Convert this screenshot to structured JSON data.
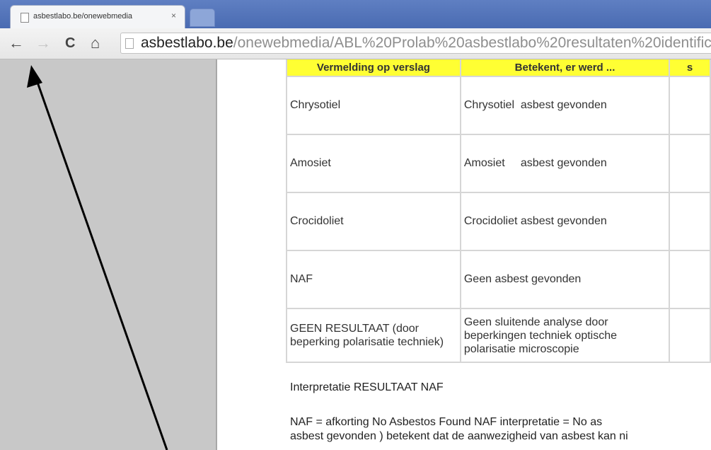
{
  "tab": {
    "title": "asbestlabo.be/onewebmedia",
    "close_label": "×"
  },
  "toolbar": {
    "back_icon": "←",
    "forward_icon": "→",
    "reload_icon": "C",
    "home_icon": "⌂",
    "url_host": "asbestlabo.be",
    "url_path": "/onewebmedia/ABL%20Prolab%20asbestlabo%20resultaten%20identifica"
  },
  "table": {
    "headers": [
      "Vermelding op verslag",
      "Betekent, er werd ...",
      "s"
    ],
    "rows": [
      [
        "Chrysotiel",
        "Chrysotiel  asbest gevonden"
      ],
      [
        "Amosiet",
        "Amosiet     asbest gevonden"
      ],
      [
        "Crocidoliet",
        "Crocidoliet asbest gevonden"
      ],
      [
        "NAF",
        "Geen asbest gevonden"
      ],
      [
        "GEEN RESULTAAT (door beperking polarisatie techniek)",
        "Geen sluitende analyse door beperkingen techniek optische polarisatie microscopie"
      ]
    ]
  },
  "interpretation_title": "Interpretatie RESULTAAT NAF",
  "paragraph": {
    "line1": "NAF = afkorting    No Asbestos Found NAF interpretatie =  No as",
    "line2": "asbest gevonden ) betekent dat de aanwezigheid van asbest kan ni"
  },
  "annotation": {
    "icon": "arrow-annotation-icon",
    "color": "#000000"
  }
}
